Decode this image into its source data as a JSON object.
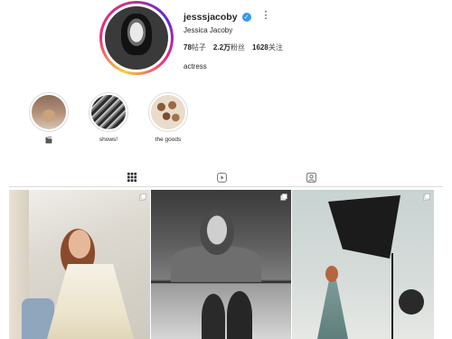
{
  "profile": {
    "username": "jesssjacoby",
    "verified_mark": "✓",
    "more_icon": "⋮",
    "full_name": "Jessica Jacoby",
    "stats": [
      {
        "value": "78",
        "label": "帖子"
      },
      {
        "value": "2.2万",
        "label": "粉丝"
      },
      {
        "value": "1628",
        "label": "关注"
      }
    ],
    "bio": "actress"
  },
  "highlights": [
    {
      "label": "🎬"
    },
    {
      "label": "shows!"
    },
    {
      "label": "the goods"
    }
  ],
  "tabs": [
    {
      "name": "posts",
      "icon": "grid-icon",
      "active": true
    },
    {
      "name": "reels",
      "icon": "reels-icon",
      "active": false
    },
    {
      "name": "tagged",
      "icon": "tagged-icon",
      "active": false
    }
  ],
  "colors": {
    "verified": "#3897f0",
    "text": "#262626",
    "divider": "#dbdbdb"
  }
}
